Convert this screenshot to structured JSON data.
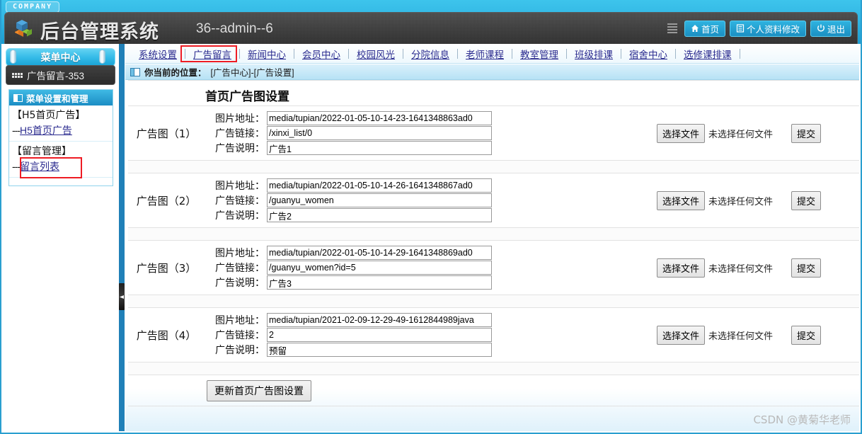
{
  "header": {
    "company_badge": "COMPANY",
    "site_title": "后台管理系统",
    "admin_label": "36--admin--6",
    "menu_icon": "hamburger-icon",
    "buttons": [
      {
        "label": "首页",
        "icon": "home-icon"
      },
      {
        "label": "个人资料修改",
        "icon": "profile-icon"
      },
      {
        "label": "退出",
        "icon": "power-icon"
      }
    ]
  },
  "sidebar": {
    "menu_center_title": "菜单中心",
    "plate_title": "广告留言-353",
    "box_head": "菜单设置和管理",
    "groups": [
      {
        "title": "【H5首页广告】",
        "links": [
          {
            "dash": "---",
            "label": "H5首页广告",
            "highlighted": true
          }
        ]
      },
      {
        "title": "【留言管理】",
        "links": [
          {
            "dash": "---",
            "label": "留言列表",
            "highlighted": false
          }
        ]
      }
    ]
  },
  "nav": {
    "tabs": [
      "系统设置",
      "广告留言",
      "新闻中心",
      "会员中心",
      "校园风光",
      "分院信息",
      "老师课程",
      "教室管理",
      "班级排课",
      "宿舍中心",
      "选修课排课"
    ],
    "active_tab": "广告留言"
  },
  "breadcrumb": {
    "prefix": "你当前的位置：",
    "path": "[广告中心]-[广告设置]",
    "icon": "window-icon"
  },
  "main": {
    "page_title": "首页广告图设置",
    "field_labels": {
      "image": "图片地址：",
      "link": "广告链接：",
      "desc": "广告说明："
    },
    "file_button_label": "选择文件",
    "no_file_text": "未选择任何文件",
    "submit_label": "提交",
    "update_button_label": "更新首页广告图设置",
    "rows": [
      {
        "name": "广告图（1）",
        "image": "media/tupian/2022-01-05-10-14-23-1641348863ad0",
        "link": "/xinxi_list/0",
        "desc": "广告1"
      },
      {
        "name": "广告图（2）",
        "image": "media/tupian/2022-01-05-10-14-26-1641348867ad0",
        "link": "/guanyu_women",
        "desc": "广告2"
      },
      {
        "name": "广告图（3）",
        "image": "media/tupian/2022-01-05-10-14-29-1641348869ad0",
        "link": "/guanyu_women?id=5",
        "desc": "广告3"
      },
      {
        "name": "广告图（4）",
        "image": "media/tupian/2021-02-09-12-29-49-1612844989java",
        "link": "2",
        "desc": "预留"
      }
    ]
  },
  "watermark": "CSDN @黄菊华老师",
  "colors": {
    "accent": "#29a9dc",
    "highlight": "#ee1c24",
    "link": "#2b2b8f",
    "plate": "#333333"
  }
}
